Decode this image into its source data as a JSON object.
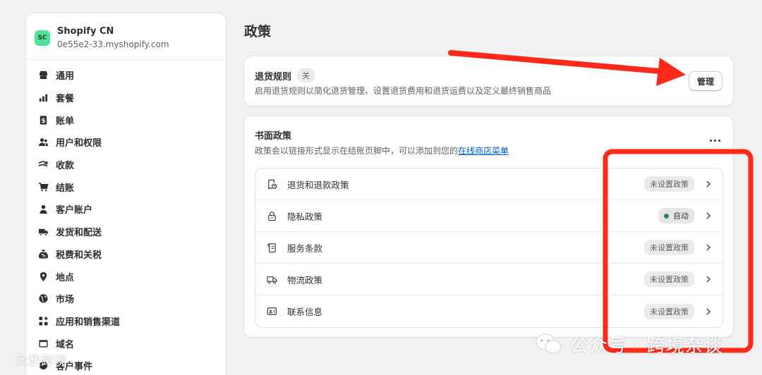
{
  "store": {
    "avatar_initials": "SC",
    "name": "Shopify CN",
    "domain": "0e55e2-33.myshopify.com"
  },
  "sidebar": {
    "items": [
      {
        "label": "通用",
        "icon": "store-icon"
      },
      {
        "label": "套餐",
        "icon": "plan-chart-icon"
      },
      {
        "label": "账单",
        "icon": "billing-icon"
      },
      {
        "label": "用户和权限",
        "icon": "users-icon"
      },
      {
        "label": "收款",
        "icon": "payments-icon"
      },
      {
        "label": "结账",
        "icon": "cart-icon"
      },
      {
        "label": "客户账户",
        "icon": "person-icon"
      },
      {
        "label": "发货和配送",
        "icon": "truck-icon"
      },
      {
        "label": "税费和关税",
        "icon": "tax-bag-icon"
      },
      {
        "label": "地点",
        "icon": "location-pin-icon"
      },
      {
        "label": "市场",
        "icon": "globe-icon"
      },
      {
        "label": "应用和销售渠道",
        "icon": "apps-icon"
      },
      {
        "label": "域名",
        "icon": "domain-icon"
      },
      {
        "label": "客户事件",
        "icon": "events-icon"
      }
    ]
  },
  "page": {
    "title": "政策"
  },
  "return_rules": {
    "title": "退货规则",
    "status": "关",
    "description": "启用退货规则以简化退货管理、设置退货费用和退货运费以及定义最终销售商品",
    "manage_label": "管理"
  },
  "written_policies": {
    "title": "书面政策",
    "description_prefix": "政策会以链接形式显示在结账页脚中，可以添加到您的",
    "link_text": "在线商店菜单",
    "rows": [
      {
        "name": "退货和退款政策",
        "status": "未设置政策",
        "active": false,
        "icon": "refund-receipt-icon"
      },
      {
        "name": "隐私政策",
        "status": "自动",
        "active": true,
        "icon": "lock-icon"
      },
      {
        "name": "服务条款",
        "status": "未设置政策",
        "active": false,
        "icon": "terms-scroll-icon"
      },
      {
        "name": "物流政策",
        "status": "未设置政策",
        "active": false,
        "icon": "shipping-truck-icon"
      },
      {
        "name": "联系信息",
        "status": "未设置政策",
        "active": false,
        "icon": "contact-card-icon"
      }
    ]
  },
  "annotations": {
    "arrow_color": "#ff2a1a",
    "box_color": "#ff2a1a"
  },
  "watermark": {
    "main": "公众号 · 跨境杂谈",
    "corner": "大数跨境"
  },
  "colors": {
    "avatar_bg": "#4fe39a",
    "link": "#005bd3",
    "active_dot": "#29845a"
  }
}
